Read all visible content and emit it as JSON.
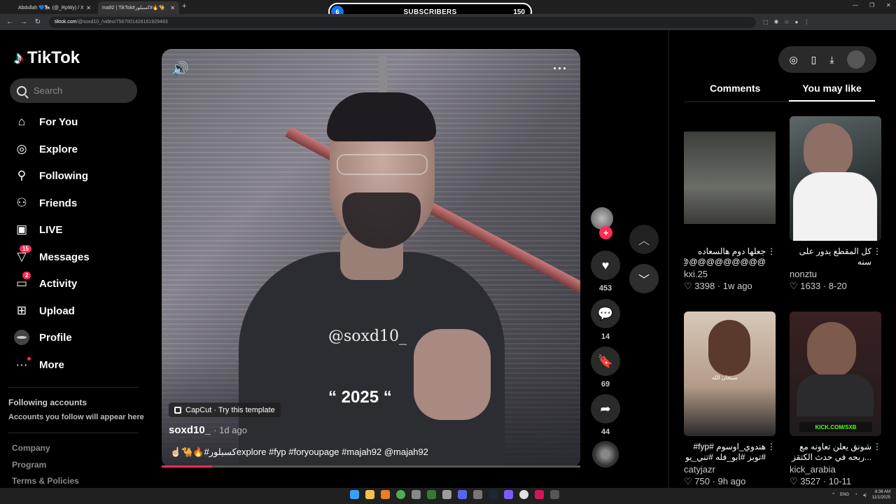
{
  "browser": {
    "tabs": [
      {
        "title": "Abdullah 💙🎠 (@_RpWy) / X"
      },
      {
        "title": "ma92 | TikTok#كسبلور#🔥🐪"
      }
    ],
    "url_host": "tiktok.com",
    "url_path": "/@soxd10_/video/7567001426161929493",
    "subscribers": {
      "current": "6",
      "label": "SUBSCRIBERS",
      "goal": "150"
    }
  },
  "sidebar": {
    "logo": "TikTok",
    "search_placeholder": "Search",
    "items": [
      {
        "label": "For You",
        "icon": "home-icon"
      },
      {
        "label": "Explore",
        "icon": "compass-icon"
      },
      {
        "label": "Following",
        "icon": "following-icon"
      },
      {
        "label": "Friends",
        "icon": "friends-icon"
      },
      {
        "label": "LIVE",
        "icon": "live-icon"
      },
      {
        "label": "Messages",
        "icon": "messages-icon",
        "badge": "15"
      },
      {
        "label": "Activity",
        "icon": "activity-icon",
        "badge": "2"
      },
      {
        "label": "Upload",
        "icon": "upload-icon"
      },
      {
        "label": "Profile",
        "icon": "avatar"
      },
      {
        "label": "More",
        "icon": "more-icon"
      }
    ],
    "following_title": "Following accounts",
    "following_sub": "Accounts you follow will appear here",
    "footer": [
      "Company",
      "Program",
      "Terms & Policies"
    ]
  },
  "video": {
    "watermark": "@soxd10_",
    "year_text": "“ 2025 “",
    "capcut": "CapCut · Try this template",
    "author": "soxd10_",
    "ago": "1d ago",
    "caption": "☝🏻🐪🔥#كسبلورexplore #fyp #foryoupage #majah92 @majah92",
    "progress_pct": 12
  },
  "actions": {
    "likes": "453",
    "comments": "14",
    "saves": "69",
    "shares": "44"
  },
  "panel": {
    "tabs": [
      "Comments",
      "You may like"
    ],
    "active_tab": "You may like",
    "cards": [
      {
        "title": "جعلها دوم هالسعاده\n@@@@@@@@@@@@@@@@...",
        "user": "kxi.25",
        "likes": "3398",
        "when": "1w ago"
      },
      {
        "title": "كل المقطع يدور على سنه\n😳 #theultimate...",
        "user": "nonztu",
        "likes": "1633",
        "when": "8-20"
      },
      {
        "title": "هندوي_اوسوم #fyp#\n#توبز #ابو_فله #تني_يو",
        "user": "catyjazr",
        "likes": "750",
        "when": "9h ago"
      },
      {
        "title": "شونق يعلن تعاونه مع\n...ربحه في حدث الكتقز ليق",
        "user": "kick_arabia",
        "likes": "3527",
        "when": "10-11"
      }
    ],
    "thumb_texts": {
      "c3": "سبحان الله",
      "c4_bar": "KICK.COM/SXB"
    }
  },
  "taskbar": {
    "lang": "ENG",
    "time": "8:36 AM",
    "date": "11/1/2025"
  }
}
